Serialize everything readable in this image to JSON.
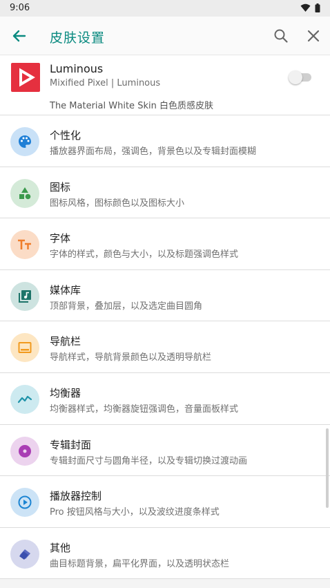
{
  "status_bar": {
    "time": "9:06",
    "wifi_icon": "wifi-icon",
    "battery_icon": "battery-icon"
  },
  "app_bar": {
    "title": "皮肤设置",
    "back_icon": "arrow-back-icon",
    "search_icon": "search-icon",
    "close_icon": "close-icon"
  },
  "skin": {
    "name": "Luminous",
    "author": "Mixified Pixel | Luminous",
    "description": "The Material White Skin 白色质感皮肤",
    "enabled": false,
    "logo_color": "#e5303f"
  },
  "menu": [
    {
      "title": "个性化",
      "subtitle": "播放器界面布局，强调色，背景色以及专辑封面模糊",
      "icon": "palette-icon",
      "bg": "#c9e1f7",
      "fg": "#1e7fd6"
    },
    {
      "title": "图标",
      "subtitle": "图标风格，图标颜色以及图标大小",
      "icon": "shapes-icon",
      "bg": "#d4ead8",
      "fg": "#3a9a4c"
    },
    {
      "title": "字体",
      "subtitle": "字体的样式，颜色与大小，以及标题强调色样式",
      "icon": "text-size-icon",
      "bg": "#fbdcc6",
      "fg": "#ef7d2a"
    },
    {
      "title": "媒体库",
      "subtitle": "顶部背景，叠加层，以及选定曲目圆角",
      "icon": "library-music-icon",
      "bg": "#cde3e0",
      "fg": "#1d7469"
    },
    {
      "title": "导航栏",
      "subtitle": "导航样式，导航背景颜色以及透明导航栏",
      "icon": "navigation-bar-icon",
      "bg": "#fde6c2",
      "fg": "#f19a1e"
    },
    {
      "title": "均衡器",
      "subtitle": "均衡器样式，均衡器旋钮强调色，音量面板样式",
      "icon": "equalizer-icon",
      "bg": "#cdeaf0",
      "fg": "#1f93a9"
    },
    {
      "title": "专辑封面",
      "subtitle": "专辑封面尺寸与圆角半径，以及专辑切换过渡动画",
      "icon": "album-disc-icon",
      "bg": "#ecd3ee",
      "fg": "#a93db4"
    },
    {
      "title": "播放器控制",
      "subtitle": "Pro 按钮风格与大小，以及波纹进度条样式",
      "icon": "play-circle-icon",
      "bg": "#cce3f6",
      "fg": "#1c84d2"
    },
    {
      "title": "其他",
      "subtitle": "曲目标题背景，扁平化界面，以及透明状态栏",
      "icon": "cards-icon",
      "bg": "#d6d8ee",
      "fg": "#3b4fae"
    }
  ]
}
